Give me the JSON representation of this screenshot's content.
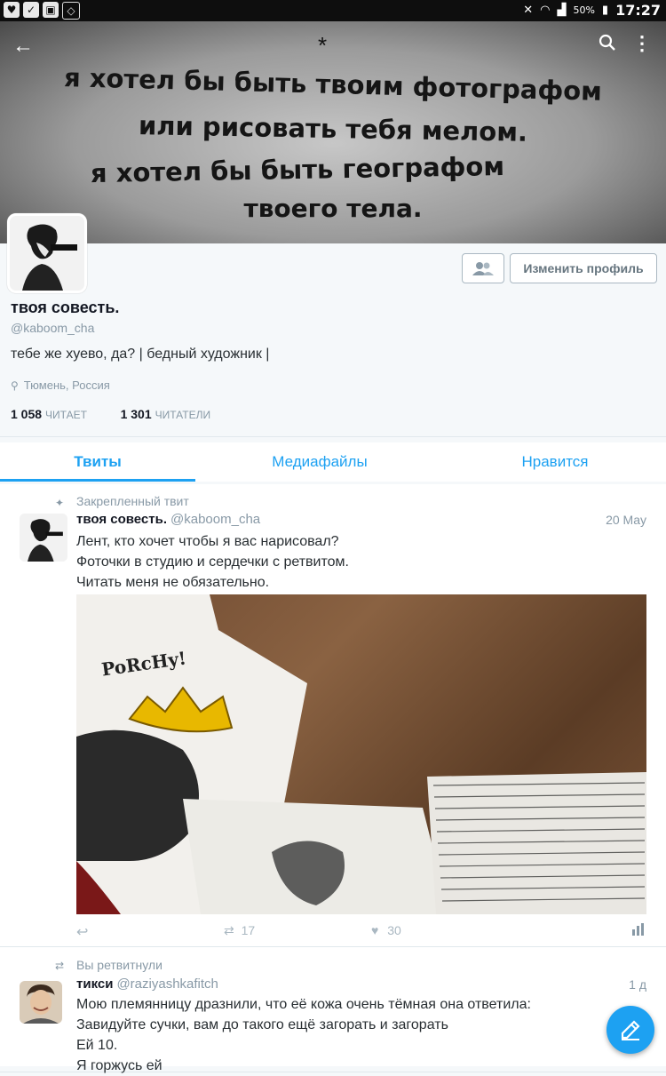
{
  "status_bar": {
    "battery_percent": "50%",
    "time": "17:27"
  },
  "banner": {
    "star": "*",
    "lines": [
      "я хотел бы быть твоим фотографом",
      "или рисовать тебя мелом.",
      "я хотел бы быть географом",
      "твоего тела."
    ]
  },
  "profile": {
    "name": "твоя совесть.",
    "handle": "@kaboom_cha",
    "bio": "тебе же хуево, да? | бедный художник |",
    "location": "Тюмень, Россия",
    "following_count": "1 058",
    "following_label": "ЧИТАЕТ",
    "followers_count": "1 301",
    "followers_label": "ЧИТАТЕЛИ",
    "edit_button": "Изменить профиль"
  },
  "tabs": [
    {
      "label": "Твиты",
      "active": true
    },
    {
      "label": "Медиафайлы",
      "active": false
    },
    {
      "label": "Нравится",
      "active": false
    }
  ],
  "tweets": [
    {
      "context": "Закрепленный твит",
      "name": "твоя совесть.",
      "handle": "@kaboom_cha",
      "date": "20 May",
      "lines": [
        "Лент, кто хочет чтобы я вас нарисовал?",
        "Фоточки в студию и сердечки с ретвитом.",
        "Читать меня не обязательно."
      ],
      "media_text": "PoRcHy!",
      "retweets": "17",
      "likes": "30"
    },
    {
      "context": "Вы ретвитнули",
      "name": "тикси",
      "handle": "@raziyashkafitch",
      "date": "1 д",
      "lines": [
        "Мою племянницу дразнили, что её кожа очень тёмная она ответила:",
        "Завидуйте сучки, вам до такого ещё загорать и загорать",
        "Ей 10.",
        "Я горжусь ей"
      ]
    }
  ],
  "colors": {
    "accent": "#1da1f2",
    "muted": "#8899a6",
    "text": "#292f33"
  },
  "icons": [
    "back-arrow-icon",
    "search-icon",
    "more-icon",
    "people-icon",
    "location-pin-icon",
    "pin-icon",
    "retweet-icon",
    "reply-icon",
    "heart-icon",
    "stats-icon",
    "compose-icon"
  ]
}
